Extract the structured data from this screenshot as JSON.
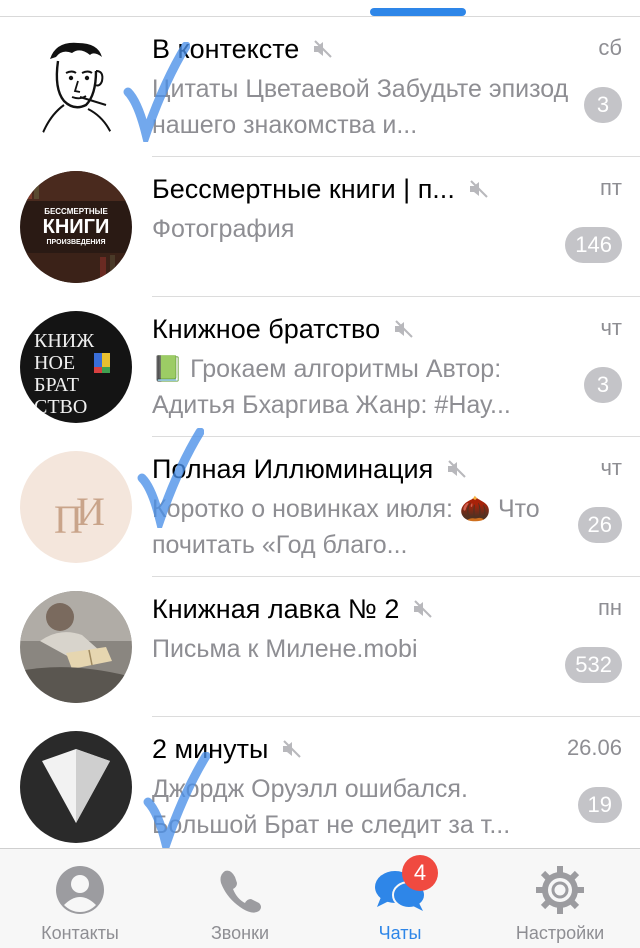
{
  "colors": {
    "accent": "#2e86e8",
    "muted_text": "#8e8e93",
    "badge_bg": "#c4c4c8",
    "notification_badge": "#f04a40"
  },
  "chats": [
    {
      "title": "В контексте",
      "date": "сб",
      "preview": "Цитаты Цветаевой Забудьте эпизод нашего знакомства и...",
      "unread": "3",
      "muted": true,
      "avatar": "sketch-face"
    },
    {
      "title": "Бессмертные книги | п...",
      "date": "пт",
      "preview": "Фотография",
      "unread": "146",
      "muted": true,
      "avatar": "immortal-books-logo",
      "avatar_text": [
        "БЕССМЕРТНЫЕ",
        "КНИГИ",
        "ПРОИЗВЕДЕНИЯ"
      ]
    },
    {
      "title": "Книжное братство",
      "date": "чт",
      "preview": "📗 Грокаем алгоритмы Автор: Адитья Бхаргива Жанр: #Нау...",
      "unread": "3",
      "muted": true,
      "avatar": "book-brotherhood-logo",
      "avatar_text": [
        "КНИЖ",
        "НОЕ",
        "БРАТ",
        "СТВО"
      ]
    },
    {
      "title": "Полная Иллюминация",
      "date": "чт",
      "preview": "Коротко о новинках июля: 🌰 Что почитать «Год благо...",
      "unread": "26",
      "muted": true,
      "avatar": "illumination-logo",
      "avatar_text": [
        "П",
        "И"
      ]
    },
    {
      "title": "Книжная лавка № 2",
      "date": "пн",
      "preview": "Письма к Милене.mobi",
      "unread": "532",
      "muted": true,
      "avatar": "reading-person-photo"
    },
    {
      "title": "2 минуты",
      "date": "26.06",
      "preview": "Джордж Оруэлл ошибался. Большой Брат не следит за т...",
      "unread": "19",
      "muted": true,
      "avatar": "paper-triangle-logo"
    }
  ],
  "tabs": [
    {
      "label": "Контакты",
      "icon": "person-icon"
    },
    {
      "label": "Звонки",
      "icon": "phone-icon"
    },
    {
      "label": "Чаты",
      "icon": "chat-bubbles-icon",
      "badge": "4",
      "active": true
    },
    {
      "label": "Настройки",
      "icon": "gear-icon"
    }
  ]
}
